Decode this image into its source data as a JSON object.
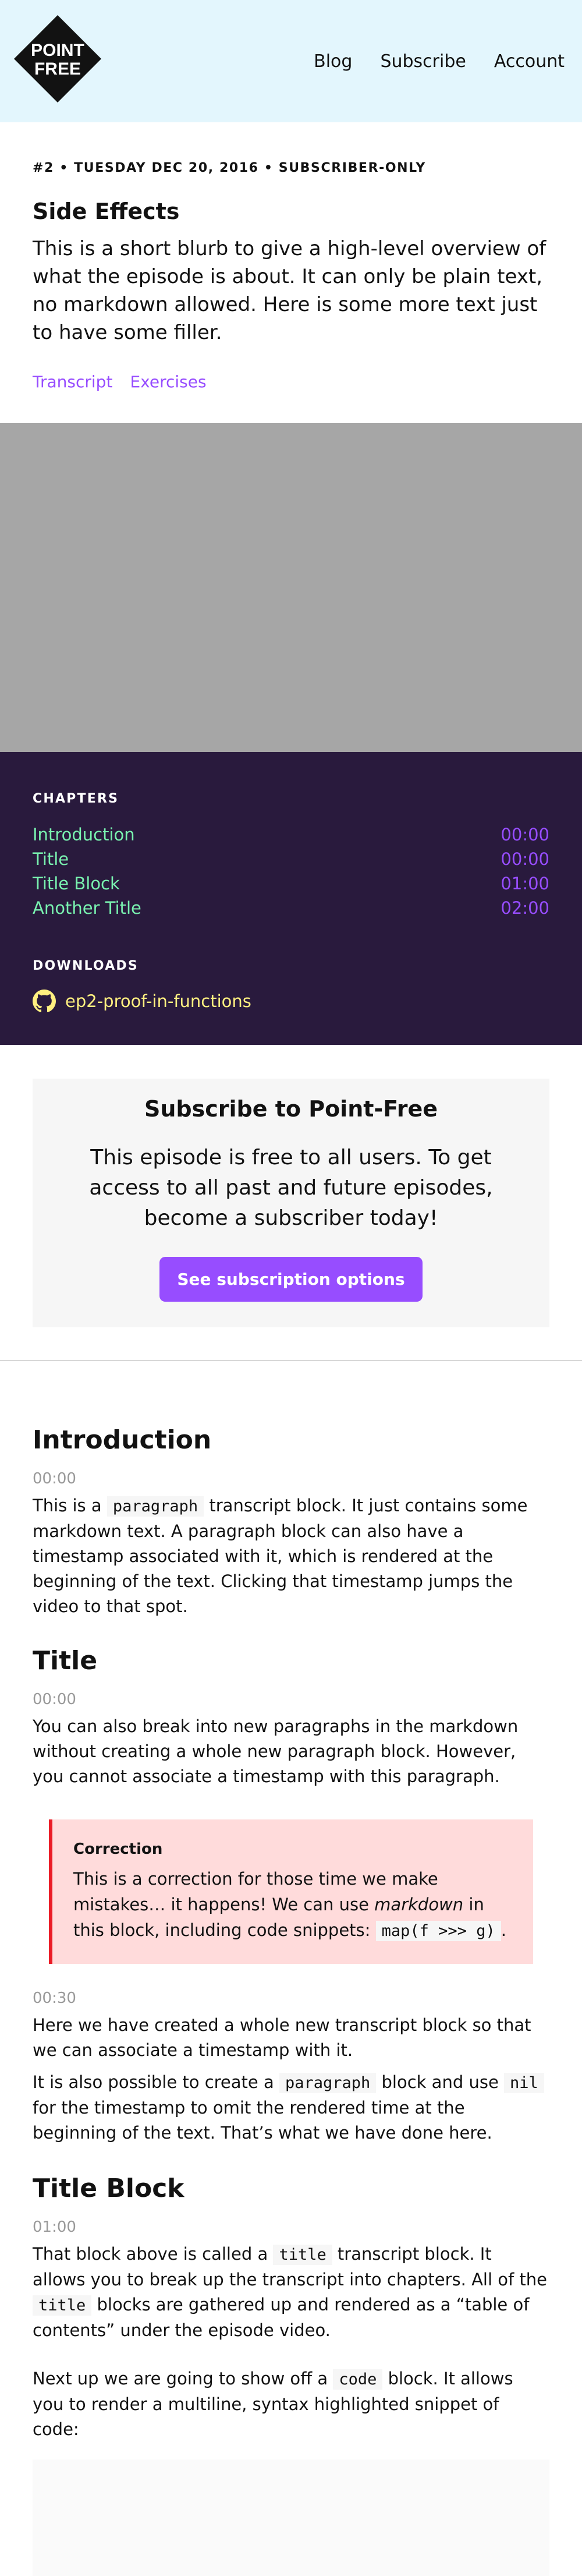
{
  "brand": {
    "logo_line1": "POINT",
    "logo_line2": "FREE"
  },
  "nav": {
    "blog": "Blog",
    "subscribe": "Subscribe",
    "account": "Account"
  },
  "episode": {
    "meta": "#2 • TUESDAY DEC 20, 2016 • SUBSCRIBER-ONLY",
    "title": "Side Effects",
    "blurb": "This is a short blurb to give a high-level overview of what the episode is about. It can only be plain text, no markdown allowed. Here is some more text just to have some filler.",
    "links": [
      "Transcript",
      "Exercises"
    ]
  },
  "chapters": {
    "label": "CHAPTERS",
    "items": [
      {
        "name": "Introduction",
        "time": "00:00"
      },
      {
        "name": "Title",
        "time": "00:00"
      },
      {
        "name": "Title Block",
        "time": "01:00"
      },
      {
        "name": "Another Title",
        "time": "02:00"
      }
    ]
  },
  "downloads": {
    "label": "DOWNLOADS",
    "file": "ep2-proof-in-functions"
  },
  "subscribe_box": {
    "title": "Subscribe to Point-Free",
    "text": "This episode is free to all users. To get access to all past and future episodes, become a subscriber today!",
    "button": "See subscription options"
  },
  "transcript": {
    "intro": {
      "heading": "Introduction",
      "time": "00:00",
      "p_before": "This is a ",
      "p_code": "paragraph",
      "p_after": " transcript block. It just contains some markdown text. A paragraph block can also have a timestamp associated with it, which is rendered at the beginning of the text. Clicking that timestamp jumps the video to that spot."
    },
    "title_section": {
      "heading": "Title",
      "time": "00:00",
      "p": "You can also break into new paragraphs in the markdown without creating a whole new paragraph block. However, you cannot associate a timestamp with this paragraph."
    },
    "correction": {
      "label": "Correction",
      "t1": "This is a correction for those time we make mistakes… it happens! We can use ",
      "em": "markdown",
      "t2": " in this block, including code snippets: ",
      "code": "map(f >>> g)",
      "t3": "."
    },
    "block2": {
      "time": "00:30",
      "p1": "Here we have created a whole new transcript block so that we can associate a timestamp with it.",
      "p2_a": "It is also possible to create a ",
      "p2_code1": "paragraph",
      "p2_b": " block and use ",
      "p2_code2": "nil",
      "p2_c": " for the timestamp to omit the rendered time at the beginning of the text. That’s what we have done here."
    },
    "title_block": {
      "heading": "Title Block",
      "time": "01:00",
      "p1_a": "That block above is called a ",
      "p1_code1": "title",
      "p1_b": " transcript block. It allows you to break up the transcript into chapters. All of the ",
      "p1_code2": "title",
      "p1_c": " blocks are gathered up and rendered as a “table of contents” under the episode video.",
      "p2_a": "Next up we are going to show off a ",
      "p2_code": "code",
      "p2_b": " block. It allows you to render a multiline, syntax highlighted snippet of code:"
    }
  },
  "colors": {
    "header_bg": "#e3f6fd",
    "purple": "#974dff",
    "dark_bg": "#291a3d",
    "green": "#79f2b0",
    "yellow": "#fff080",
    "correction_bg": "#ffdbdb",
    "correction_border": "#eb1c26"
  }
}
